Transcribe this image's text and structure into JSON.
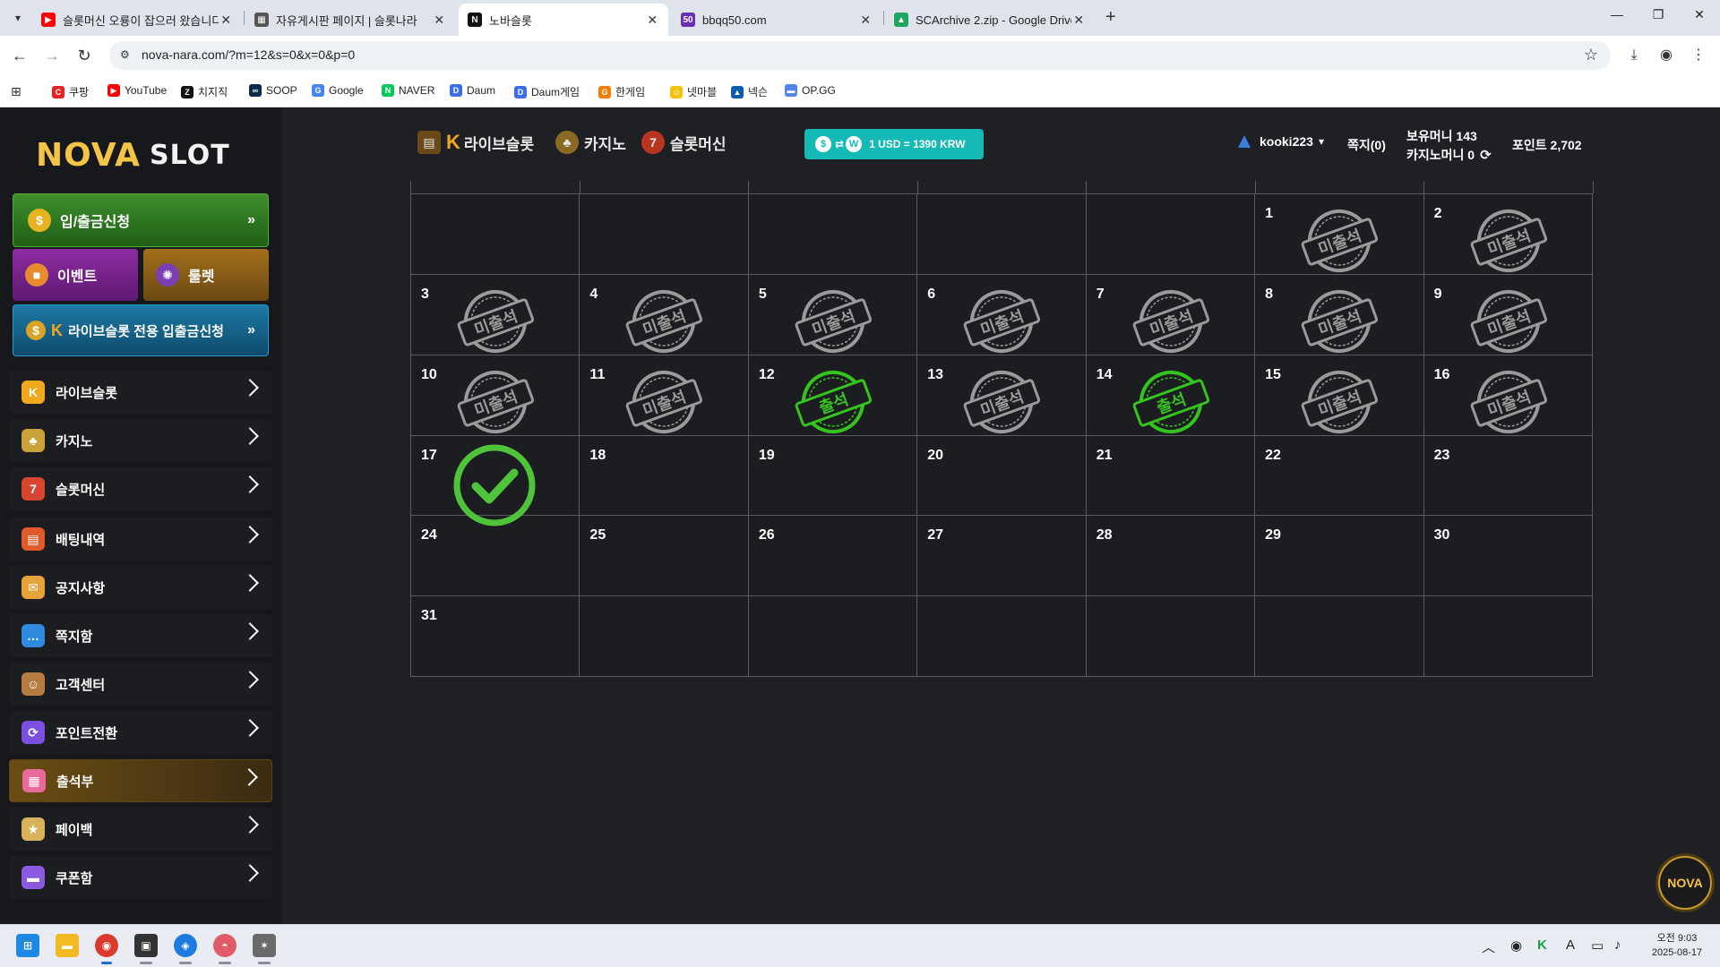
{
  "browser": {
    "tabs": [
      {
        "title": "슬롯머신 오룡이 잡으러 왔습니다",
        "icon": "youtube-icon",
        "color": "#ff0000",
        "glyph": "▶"
      },
      {
        "title": "자유게시판 페이지 | 슬롯나라",
        "icon": "board-icon",
        "color": "#555555",
        "glyph": "▦"
      },
      {
        "title": "노바슬롯",
        "icon": "nova-icon",
        "color": "#111111",
        "glyph": "N"
      },
      {
        "title": "bbqq50.com",
        "icon": "bbqq-icon",
        "color": "#6a2fb5",
        "glyph": "50"
      },
      {
        "title": "SCArchive 2.zip - Google Drive",
        "icon": "google-drive-icon",
        "color": "#1fa463",
        "glyph": "▲"
      }
    ],
    "url": "nova-nara.com/?m=12&s=0&x=0&p=0",
    "bookmarks": [
      {
        "label": "쿠팡",
        "color": "#e52222",
        "glyph": "C"
      },
      {
        "label": "YouTube",
        "color": "#ff0000",
        "glyph": "▶"
      },
      {
        "label": "치지직",
        "color": "#111111",
        "glyph": "Z"
      },
      {
        "label": "SOOP",
        "color": "#0b2a4a",
        "glyph": "∞"
      },
      {
        "label": "Google",
        "color": "#4285f4",
        "glyph": "G"
      },
      {
        "label": "NAVER",
        "color": "#03c75a",
        "glyph": "N"
      },
      {
        "label": "Daum",
        "color": "#3b6ee8",
        "glyph": "D"
      },
      {
        "label": "Daum게임",
        "color": "#3b6ee8",
        "glyph": "D"
      },
      {
        "label": "한게임",
        "color": "#f57c00",
        "glyph": "G"
      },
      {
        "label": "넷마블",
        "color": "#f2c40f",
        "glyph": "☺"
      },
      {
        "label": "넥슨",
        "color": "#0b5cab",
        "glyph": "▲"
      },
      {
        "label": "OP.GG",
        "color": "#5383e8",
        "glyph": "▬"
      }
    ]
  },
  "site": {
    "logo_left": "NOVA",
    "logo_right": "SLOT",
    "deposit_button": "입/출금신청",
    "event_button": "이벤트",
    "roulette_button": "룰렛",
    "live_deposit_button": "라이브슬롯 전용 입출금신청",
    "menu": [
      {
        "label": "라이브슬롯",
        "icon": "live-slot-icon",
        "color": "#f2a81d",
        "glyph": "K"
      },
      {
        "label": "카지노",
        "icon": "casino-icon",
        "color": "#c9a23a",
        "glyph": "♣"
      },
      {
        "label": "슬롯머신",
        "icon": "slot-machine-icon",
        "color": "#d8452f",
        "glyph": "7"
      },
      {
        "label": "배팅내역",
        "icon": "betting-history-icon",
        "color": "#e05a2a",
        "glyph": "▤"
      },
      {
        "label": "공지사항",
        "icon": "megaphone-icon",
        "color": "#e8a23a",
        "glyph": "✉"
      },
      {
        "label": "쪽지함",
        "icon": "message-icon",
        "color": "#2f8be0",
        "glyph": "…"
      },
      {
        "label": "고객센터",
        "icon": "customer-center-icon",
        "color": "#b77a3f",
        "glyph": "☺"
      },
      {
        "label": "포인트전환",
        "icon": "point-exchange-icon",
        "color": "#7b4fe0",
        "glyph": "⟳"
      },
      {
        "label": "출석부",
        "icon": "attendance-icon",
        "color": "#e86a9a",
        "glyph": "▦"
      },
      {
        "label": "페이백",
        "icon": "payback-icon",
        "color": "#d9b35a",
        "glyph": "★"
      },
      {
        "label": "쿠폰함",
        "icon": "coupon-icon",
        "color": "#8a5be0",
        "glyph": "▬"
      }
    ],
    "nav": {
      "live_slot": "라이브슬롯",
      "casino": "카지노",
      "slot_machine": "슬롯머신"
    },
    "exchange_rate": "1 USD = 1390 KRW",
    "username": "kooki223",
    "messages": "쪽지(0)",
    "money": "보유머니 143",
    "casino_money": "카지노머니 0",
    "points": "포인트 2,702",
    "nova_badge": "NOVA"
  },
  "calendar": {
    "leading_blank": 5,
    "days": [
      {
        "d": "1",
        "s": "absent"
      },
      {
        "d": "2",
        "s": "absent"
      },
      {
        "d": "3",
        "s": "absent"
      },
      {
        "d": "4",
        "s": "absent"
      },
      {
        "d": "5",
        "s": "absent"
      },
      {
        "d": "6",
        "s": "absent"
      },
      {
        "d": "7",
        "s": "absent"
      },
      {
        "d": "8",
        "s": "absent"
      },
      {
        "d": "9",
        "s": "absent"
      },
      {
        "d": "10",
        "s": "absent"
      },
      {
        "d": "11",
        "s": "absent"
      },
      {
        "d": "12",
        "s": "present"
      },
      {
        "d": "13",
        "s": "absent"
      },
      {
        "d": "14",
        "s": "present"
      },
      {
        "d": "15",
        "s": "absent"
      },
      {
        "d": "16",
        "s": "absent"
      },
      {
        "d": "17",
        "s": "today"
      },
      {
        "d": "18",
        "s": "none"
      },
      {
        "d": "19",
        "s": "none"
      },
      {
        "d": "20",
        "s": "none"
      },
      {
        "d": "21",
        "s": "none"
      },
      {
        "d": "22",
        "s": "none"
      },
      {
        "d": "23",
        "s": "none"
      },
      {
        "d": "24",
        "s": "none"
      },
      {
        "d": "25",
        "s": "none"
      },
      {
        "d": "26",
        "s": "none"
      },
      {
        "d": "27",
        "s": "none"
      },
      {
        "d": "28",
        "s": "none"
      },
      {
        "d": "29",
        "s": "none"
      },
      {
        "d": "30",
        "s": "none"
      },
      {
        "d": "31",
        "s": "none"
      }
    ],
    "absent_label": "미출석",
    "present_label": "출석",
    "absent_color": "#9a9a9a",
    "present_color": "#35c41f",
    "check_color": "#4fc33a"
  },
  "taskbar": {
    "time": "오전 9:03",
    "date": "2025-08-17"
  }
}
